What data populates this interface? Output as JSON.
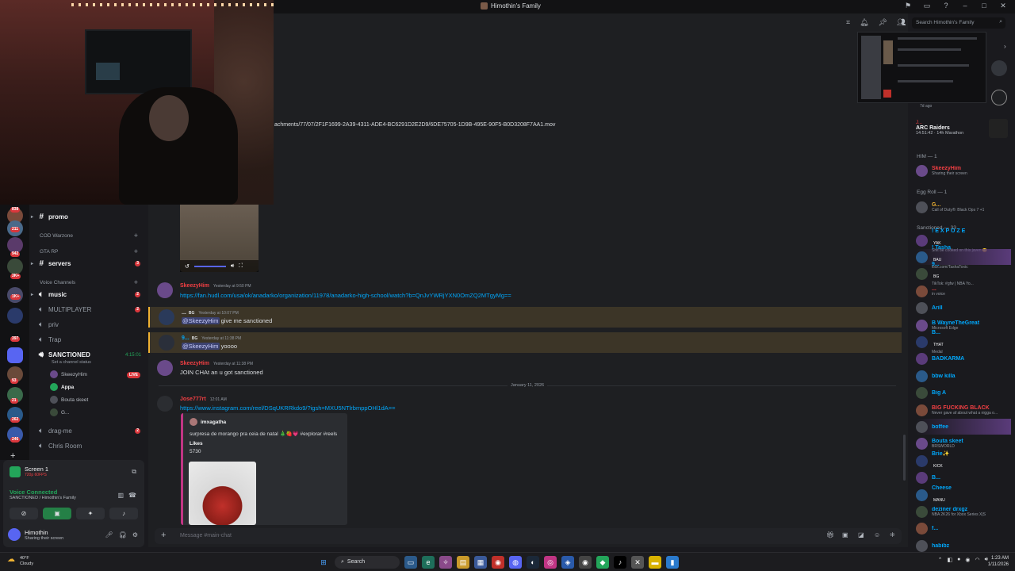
{
  "window": {
    "title": "Himothin's Family"
  },
  "header": {
    "search_placeholder": "Search Himothin's Family"
  },
  "attachment": {
    "filename_fragment": "achments/77/07/2F1F1699-2A39-4311-ADE4-BC6291D2E2D9/6DE75705-1D9B-495E-90F5-B0D3208F7AA1.mov"
  },
  "server_rail": {
    "badges": [
      "838",
      "211",
      "942",
      "3K+",
      "1K+",
      "397",
      "93",
      "21",
      "262",
      "246"
    ]
  },
  "channels": {
    "promo": "promo",
    "cat_cod": "COD Warzone",
    "cat_gta": "GTA RP",
    "servers": "servers",
    "servers_count": "3",
    "cat_voice": "Voice Channels",
    "music": "music",
    "music_count": "2",
    "multiplayer": "MULTIPLAYER",
    "multiplayer_count": "2",
    "priv": "priv",
    "trap": "Trap",
    "sanctioned": "SANCTIONED",
    "sanctioned_timer": "4:15:01",
    "sanctioned_status": "Set a channel status",
    "voice_users": [
      "SkeezyHim",
      "Appa",
      "Bouta skeet",
      "G..."
    ],
    "live_label": "LIVE",
    "dragme": "drag-me",
    "dragme_count": "2",
    "chris_room": "Chris Room"
  },
  "panel": {
    "screen_title": "Screen 1",
    "screen_sub": "720p 60FPS",
    "voice_status": "Voice Connected",
    "voice_location": "SANCTIONED / Himothin's Family",
    "username": "Himothin",
    "user_status": "Sharing their screen"
  },
  "messages": [
    {
      "author": "SkeezyHim",
      "time": "Yesterday at 9:50 PM",
      "link": "https://fan.hudl.com/usa/ok/anadarko/organization/11978/anadarko-high-school/watch?b=QnJvYWRjYXN0OmZQ2MTgyMg=="
    },
    {
      "author": "...",
      "tag": "BG",
      "time": "Yesterday at 10:07 PM",
      "mention": "@SkeezyHim",
      "text": "give me sanctioned"
    },
    {
      "author": "9...",
      "tag": "BG",
      "time": "Yesterday at 11:38 PM",
      "mention": "@SkeezyHim",
      "text": "yoooo"
    },
    {
      "author": "SkeezyHim",
      "time": "Yesterday at 11:38 PM",
      "text": "JOIN CHAt an u got sanctioned"
    },
    {
      "author": "Jose777rt",
      "time": "12:01 AM",
      "link": "https://www.instagram.com/reel/DSqUKRRkdo9/?igsh=MXU5NTlrbmppOHl1dA=="
    }
  ],
  "date_divider": "January 11, 2026",
  "embed": {
    "author": "imxagatha",
    "description": "surpresa de morango pra ceia de natal 🎄🍓💗 #explorar #reels",
    "field_label": "Likes",
    "field_value": "5730"
  },
  "composer": {
    "placeholder": "Message #main-chat"
  },
  "member_list": {
    "arc_title": "ARC Raiders",
    "arc_sub": "14:51:42 · 14h Marathon",
    "arc_prev": "7d ago",
    "arc_prev_name": "J...",
    "groups": [
      {
        "heading": "HIM — 1",
        "members": [
          {
            "name": "SkeezyHim",
            "status": "Sharing their screen",
            "color": "#f23f43"
          }
        ]
      },
      {
        "heading": "Egg Roll — 1",
        "members": [
          {
            "name": "G...",
            "status": "Call of Duty®: Black Ops 7 +1",
            "color": "#f0b232"
          }
        ]
      },
      {
        "heading": "Sanctioned — 33",
        "members": [
          {
            "name": "! E X P O Z E",
            "tag": "YAK",
            "status": "Shit be cooked on this javen 😩",
            "color": "#00a8fc"
          },
          {
            "name": "! Tasha",
            "tag": "BAU",
            "status": "kick.com/TashaToxic",
            "color": "#00a8fc"
          },
          {
            "name": "9...",
            "tag": "BG",
            "status": "TikTok: #gfw | NBA Yo...",
            "color": "#00a8fc"
          },
          {
            "name": "...",
            "status": "in voice",
            "color": "#f23f43"
          },
          {
            "name": "Arill",
            "status": "",
            "color": "#00a8fc"
          },
          {
            "name": "B WayneTheGreat",
            "status": "Microsoft Edge",
            "color": "#00a8fc"
          },
          {
            "name": "B...",
            "tag": "THAT",
            "status": "Medal",
            "color": "#00a8fc"
          },
          {
            "name": "BADKARMA",
            "status": "",
            "color": "#00a8fc"
          },
          {
            "name": "bbw killa",
            "status": "",
            "color": "#00a8fc"
          },
          {
            "name": "Big A",
            "status": "",
            "color": "#00a8fc"
          },
          {
            "name": "BIG FUCKING BLACK",
            "status": "Never gave af about what a nigga o...",
            "color": "#f23f43"
          },
          {
            "name": "boffee",
            "status": "",
            "color": "#00a8fc"
          },
          {
            "name": "Bouta skeet",
            "status": "BRSWORLD",
            "color": "#00a8fc"
          },
          {
            "name": "Brie✨",
            "tag": "KICK",
            "status": "",
            "color": "#00a8fc"
          },
          {
            "name": "B...",
            "status": "",
            "color": "#00a8fc"
          },
          {
            "name": "Cheese",
            "tag": "MANU",
            "status": "",
            "color": "#00a8fc"
          },
          {
            "name": "deziner drxgz",
            "status": "NBA 2K26 for Xbox Series X|S",
            "color": "#00a8fc"
          },
          {
            "name": "f...",
            "status": "",
            "color": "#00a8fc"
          },
          {
            "name": "habibz",
            "status": "",
            "color": "#00a8fc"
          }
        ]
      }
    ]
  },
  "taskbar": {
    "weather_temp": "40°F",
    "weather_desc": "Cloudy",
    "search_label": "Search",
    "time": "1:23 AM",
    "date": "1/11/2026"
  }
}
